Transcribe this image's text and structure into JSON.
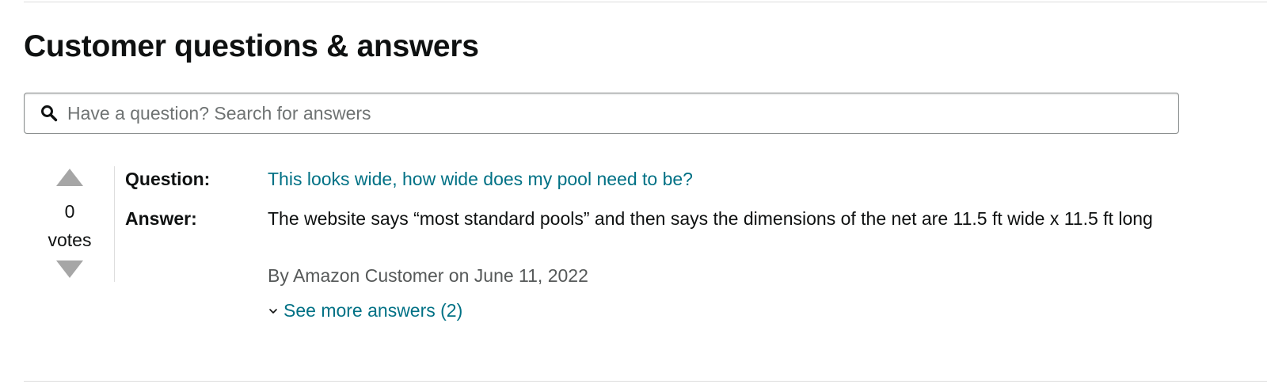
{
  "section": {
    "title": "Customer questions & answers"
  },
  "search": {
    "placeholder": "Have a question? Search for answers",
    "value": "",
    "icon": "search-icon"
  },
  "qa": {
    "votes": {
      "count": "0",
      "label": "votes",
      "up_icon": "triangle-up-icon",
      "down_icon": "triangle-down-icon"
    },
    "question_label": "Question:",
    "question_text": "This looks wide, how wide does my pool need to be?",
    "answer_label": "Answer:",
    "answer_text": "The website says “most standard pools” and then says the dimensions of the net are 11.5 ft wide x 11.5 ft long",
    "answer_meta": "By Amazon Customer on June 11, 2022",
    "see_more": "See more answers (2)"
  },
  "colors": {
    "link": "#007185",
    "text": "#0f1111",
    "muted": "#565959",
    "vote_arrow": "#a6a6a6",
    "divider": "#dddddd"
  }
}
